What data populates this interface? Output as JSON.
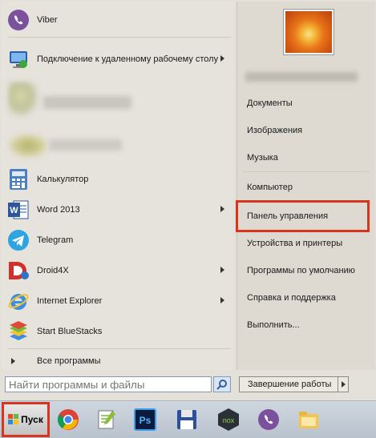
{
  "programs": [
    {
      "label": "Viber",
      "icon": "viber-icon",
      "has_submenu": false
    },
    {
      "label": "Подключение к удаленному рабочему столу",
      "icon": "remote-desktop-icon",
      "has_submenu": true
    },
    {
      "label": "Калькулятор",
      "icon": "calculator-icon",
      "has_submenu": false
    },
    {
      "label": "Word 2013",
      "icon": "word-icon",
      "has_submenu": true
    },
    {
      "label": "Telegram",
      "icon": "telegram-icon",
      "has_submenu": false
    },
    {
      "label": "Droid4X",
      "icon": "droid4x-icon",
      "has_submenu": true
    },
    {
      "label": "Internet Explorer",
      "icon": "internet-explorer-icon",
      "has_submenu": true
    },
    {
      "label": "Start BlueStacks",
      "icon": "bluestacks-icon",
      "has_submenu": false
    }
  ],
  "all_programs": {
    "label": "Все программы"
  },
  "search": {
    "placeholder": "Найти программы и файлы"
  },
  "right_panel": {
    "items": [
      {
        "label": "Документы"
      },
      {
        "label": "Изображения"
      },
      {
        "label": "Музыка"
      },
      {
        "label": "Компьютер"
      },
      {
        "label": "Панель управления",
        "highlighted": true
      },
      {
        "label": "Устройства и принтеры"
      },
      {
        "label": "Программы по умолчанию"
      },
      {
        "label": "Справка и поддержка"
      },
      {
        "label": "Выполнить..."
      }
    ]
  },
  "shutdown": {
    "label": "Завершение работы"
  },
  "taskbar": {
    "start_label": "Пуск",
    "items": [
      "chrome-icon",
      "notepad-plus-icon",
      "photoshop-icon",
      "save-disk-icon",
      "nox-icon",
      "viber-icon",
      "file-explorer-icon"
    ]
  },
  "colors": {
    "highlight": "#d9341e",
    "viber": "#7b519d",
    "telegram": "#2ca5e0",
    "word": "#2b579a"
  }
}
